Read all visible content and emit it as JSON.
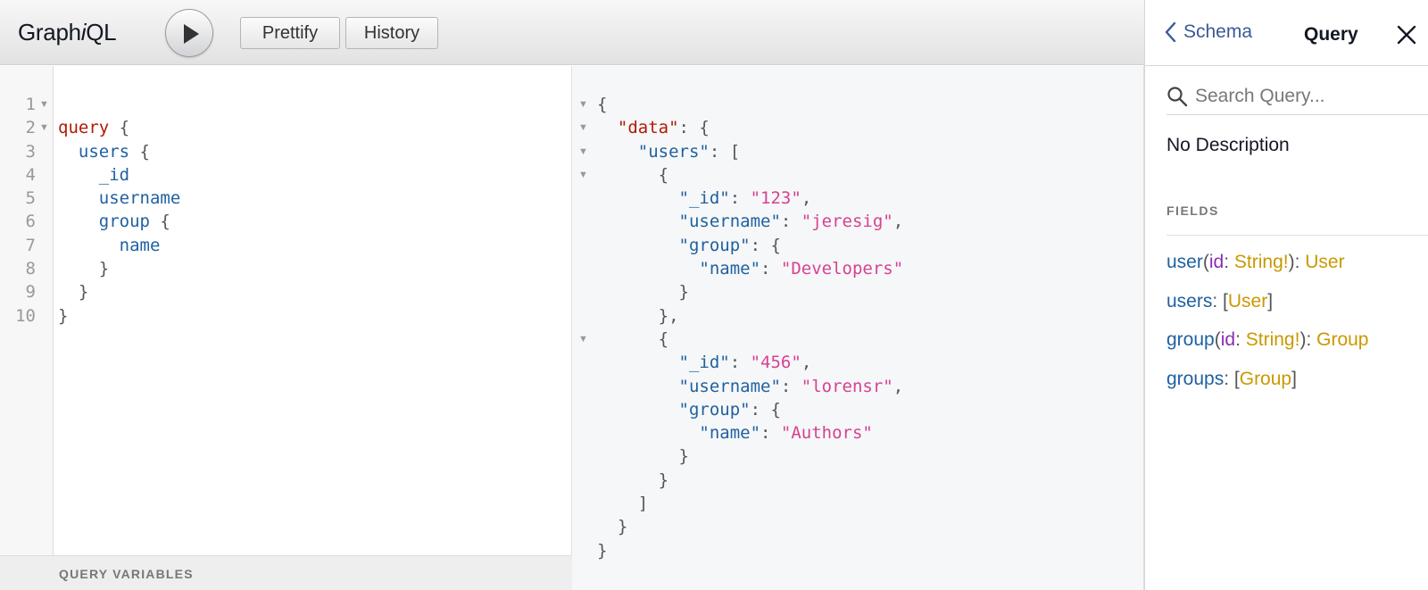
{
  "app": {
    "title_pre": "Graph",
    "title_ital": "i",
    "title_post": "QL"
  },
  "toolbar": {
    "prettify_label": "Prettify",
    "history_label": "History"
  },
  "editor": {
    "line_numbers": [
      "1",
      "2",
      "3",
      "4",
      "5",
      "6",
      "7",
      "8",
      "9",
      "10"
    ],
    "variables_label": "QUERY VARIABLES",
    "tokens": {
      "l1_kw": "query",
      "l1_brace": " {",
      "l2_field": "users",
      "l2_brace": " {",
      "l3_field": "_id",
      "l4_field": "username",
      "l5_field": "group",
      "l5_brace": " {",
      "l6_field": "name",
      "l7_brace": "}",
      "l8_brace": "}",
      "l9_brace": "}"
    }
  },
  "result": {
    "lines": [
      {
        "ind": "",
        "parts": [
          {
            "c": "punc",
            "t": "{"
          }
        ]
      },
      {
        "ind": "  ",
        "parts": [
          {
            "c": "kw",
            "t": "\"data\""
          },
          {
            "c": "punc",
            "t": ": {"
          }
        ]
      },
      {
        "ind": "    ",
        "parts": [
          {
            "c": "key",
            "t": "\"users\""
          },
          {
            "c": "punc",
            "t": ": ["
          }
        ]
      },
      {
        "ind": "      ",
        "parts": [
          {
            "c": "punc",
            "t": "{"
          }
        ]
      },
      {
        "ind": "        ",
        "parts": [
          {
            "c": "key",
            "t": "\"_id\""
          },
          {
            "c": "punc",
            "t": ": "
          },
          {
            "c": "str",
            "t": "\"123\""
          },
          {
            "c": "punc",
            "t": ","
          }
        ]
      },
      {
        "ind": "        ",
        "parts": [
          {
            "c": "key",
            "t": "\"username\""
          },
          {
            "c": "punc",
            "t": ": "
          },
          {
            "c": "str",
            "t": "\"jeresig\""
          },
          {
            "c": "punc",
            "t": ","
          }
        ]
      },
      {
        "ind": "        ",
        "parts": [
          {
            "c": "key",
            "t": "\"group\""
          },
          {
            "c": "punc",
            "t": ": {"
          }
        ]
      },
      {
        "ind": "          ",
        "parts": [
          {
            "c": "key",
            "t": "\"name\""
          },
          {
            "c": "punc",
            "t": ": "
          },
          {
            "c": "str",
            "t": "\"Developers\""
          }
        ]
      },
      {
        "ind": "        ",
        "parts": [
          {
            "c": "punc",
            "t": "}"
          }
        ]
      },
      {
        "ind": "      ",
        "parts": [
          {
            "c": "punc",
            "t": "},"
          }
        ]
      },
      {
        "ind": "      ",
        "parts": [
          {
            "c": "punc",
            "t": "{"
          }
        ]
      },
      {
        "ind": "        ",
        "parts": [
          {
            "c": "key",
            "t": "\"_id\""
          },
          {
            "c": "punc",
            "t": ": "
          },
          {
            "c": "str",
            "t": "\"456\""
          },
          {
            "c": "punc",
            "t": ","
          }
        ]
      },
      {
        "ind": "        ",
        "parts": [
          {
            "c": "key",
            "t": "\"username\""
          },
          {
            "c": "punc",
            "t": ": "
          },
          {
            "c": "str",
            "t": "\"lorensr\""
          },
          {
            "c": "punc",
            "t": ","
          }
        ]
      },
      {
        "ind": "        ",
        "parts": [
          {
            "c": "key",
            "t": "\"group\""
          },
          {
            "c": "punc",
            "t": ": {"
          }
        ]
      },
      {
        "ind": "          ",
        "parts": [
          {
            "c": "key",
            "t": "\"name\""
          },
          {
            "c": "punc",
            "t": ": "
          },
          {
            "c": "str",
            "t": "\"Authors\""
          }
        ]
      },
      {
        "ind": "        ",
        "parts": [
          {
            "c": "punc",
            "t": "}"
          }
        ]
      },
      {
        "ind": "      ",
        "parts": [
          {
            "c": "punc",
            "t": "}"
          }
        ]
      },
      {
        "ind": "    ",
        "parts": [
          {
            "c": "punc",
            "t": "]"
          }
        ]
      },
      {
        "ind": "  ",
        "parts": [
          {
            "c": "punc",
            "t": "}"
          }
        ]
      },
      {
        "ind": "",
        "parts": [
          {
            "c": "punc",
            "t": "}"
          }
        ]
      }
    ]
  },
  "docs": {
    "back_label": "Schema",
    "title": "Query",
    "search_placeholder": "Search Query...",
    "description": "No Description",
    "fields_heading": "FIELDS",
    "fields": [
      {
        "name": "user",
        "open": "(",
        "arg": "id",
        "sep": ": ",
        "arg_type": "String!",
        "close": "): ",
        "type_pre": "",
        "type": "User",
        "type_post": ""
      },
      {
        "name": "users",
        "open": "",
        "arg": "",
        "sep": "",
        "arg_type": "",
        "close": ": ",
        "type_pre": "[",
        "type": "User",
        "type_post": "]"
      },
      {
        "name": "group",
        "open": "(",
        "arg": "id",
        "sep": ": ",
        "arg_type": "String!",
        "close": "): ",
        "type_pre": "",
        "type": "Group",
        "type_post": ""
      },
      {
        "name": "groups",
        "open": "",
        "arg": "",
        "sep": "",
        "arg_type": "",
        "close": ": ",
        "type_pre": "[",
        "type": "Group",
        "type_post": "]"
      }
    ]
  },
  "colors": {
    "keyword": "#b11a04",
    "field": "#1f61a0",
    "string": "#d64292",
    "argument": "#8b2bb9",
    "type": "#ca9800",
    "link": "#3b5998"
  },
  "icons": {
    "run": "play-icon",
    "back": "chevron-left-icon",
    "close": "close-icon",
    "search": "search-icon",
    "fold": "fold-arrow-icon"
  }
}
